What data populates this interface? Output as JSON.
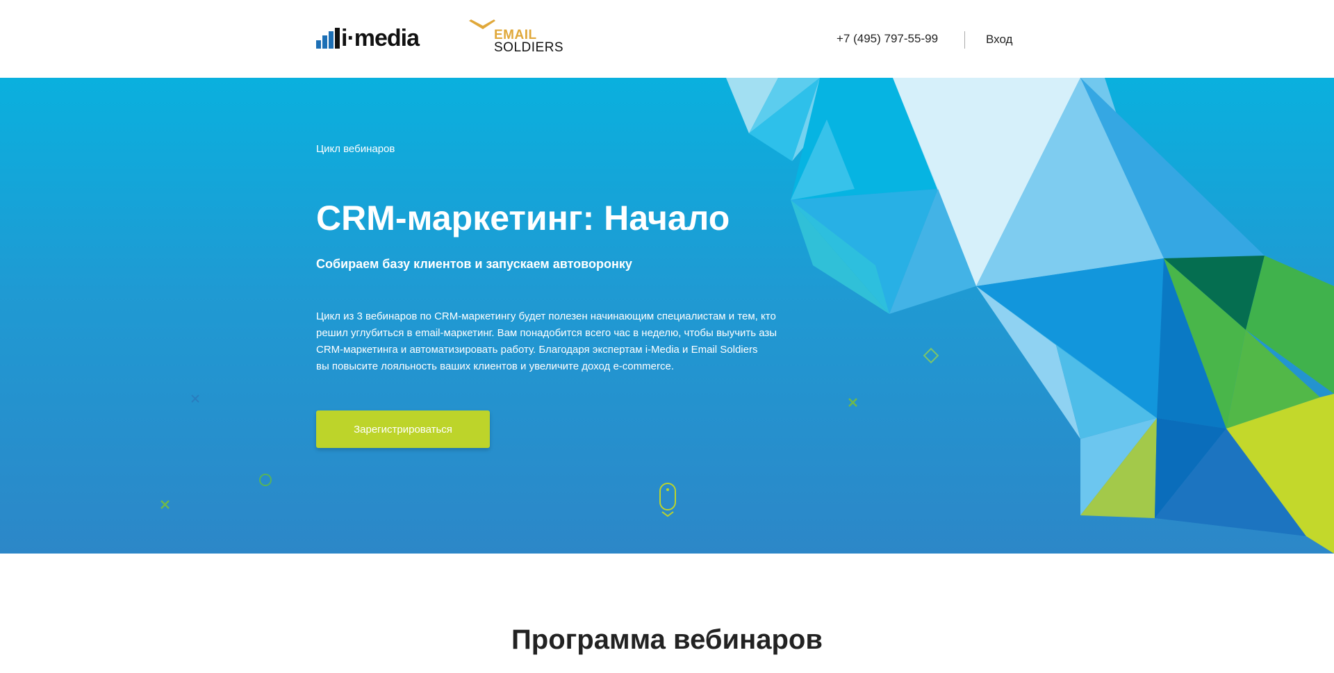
{
  "header": {
    "logo_imedia_text": "i·media",
    "logo_es_line1": "EMAIL",
    "logo_es_line2": "SOLDIERS",
    "phone": "+7 (495) 797-55-99",
    "login_label": "Вход"
  },
  "hero": {
    "series_label": "Цикл вебинаров",
    "title": "CRM-маркетинг: Начало",
    "subtitle": "Собираем базу клиентов и запускаем автоворонку",
    "description_lines": [
      "Цикл из 3 вебинаров по CRM-маркетингу будет полезен начинающим специалистам и тем, кто",
      "решил углубиться в email-маркетинг. Вам понадобится всего час в неделю, чтобы выучить азы",
      "CRM-маркетинга и автоматизировать работу. Благодаря экспертам i-Media и Email Soldiers",
      "вы повысите лояльность ваших клиентов и увеличите доход e-commerce."
    ],
    "cta_label": "Зарегистрироваться"
  },
  "program": {
    "title": "Программа вебинаров"
  },
  "icons": {
    "imedia_bars": "bar-chart-icon",
    "es_chevron": "chevron-wing-icon",
    "scroll": "mouse-scroll-icon",
    "decor": [
      "cross-icon",
      "circle-icon",
      "diamond-icon"
    ]
  },
  "colors": {
    "brand_blue": "#1c6fb5",
    "cta_green": "#bdd42a",
    "es_gold": "#e0a83a",
    "hero_top": "#0ab0de",
    "hero_bottom": "#2c87c8"
  }
}
